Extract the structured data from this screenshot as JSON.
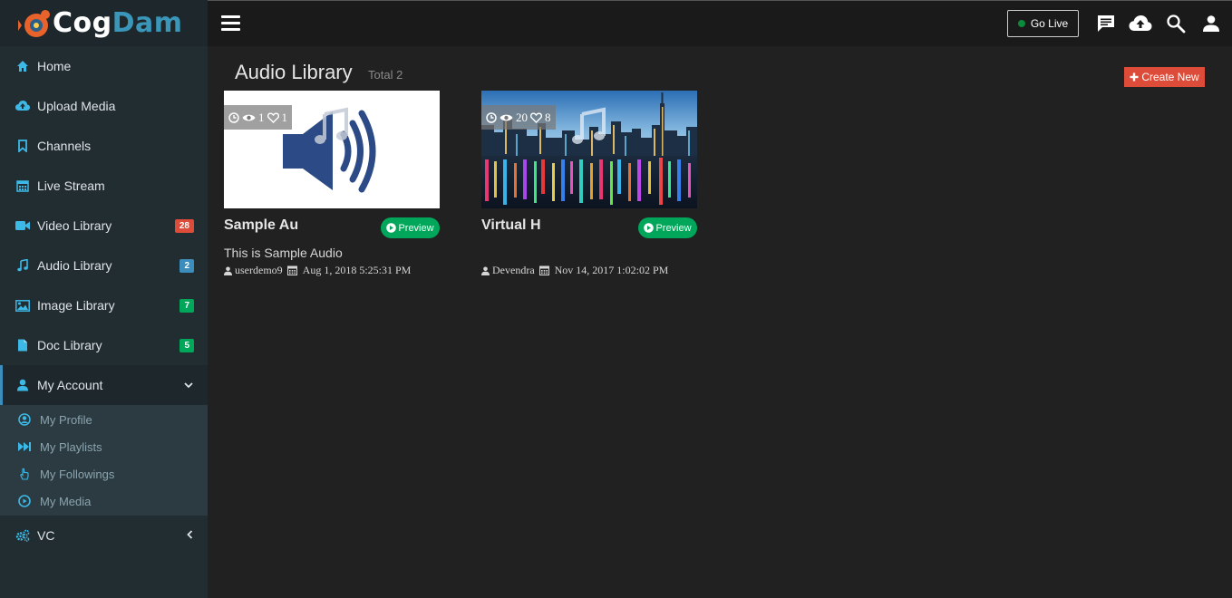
{
  "brand": {
    "logo_cog": "Cog",
    "logo_dam": "Dam"
  },
  "sidebar": {
    "items": [
      {
        "label": "Home",
        "icon": "home-icon"
      },
      {
        "label": "Upload Media",
        "icon": "cloud-upload-icon"
      },
      {
        "label": "Channels",
        "icon": "bookmark-icon"
      },
      {
        "label": "Live Stream",
        "icon": "calendar-icon"
      },
      {
        "label": "Video Library",
        "icon": "video-camera-icon",
        "badge": "28",
        "badge_color": "#dd4b39"
      },
      {
        "label": "Audio Library",
        "icon": "music-note-icon",
        "badge": "2",
        "badge_color": "#3c8dbc"
      },
      {
        "label": "Image Library",
        "icon": "image-icon",
        "badge": "7",
        "badge_color": "#00a65a"
      },
      {
        "label": "Doc Library",
        "icon": "document-icon",
        "badge": "5",
        "badge_color": "#00a65a"
      },
      {
        "label": "My Account",
        "icon": "user-icon"
      }
    ],
    "submenu": [
      {
        "label": "My Profile",
        "icon": "user-circle-icon"
      },
      {
        "label": "My Playlists",
        "icon": "fast-forward-icon"
      },
      {
        "label": "My Followings",
        "icon": "hand-pointer-icon"
      },
      {
        "label": "My Media",
        "icon": "play-circle-icon"
      }
    ],
    "vc": {
      "label": "VC",
      "icon": "cogs-icon"
    }
  },
  "header": {
    "go_live_label": "Go Live",
    "icons": [
      "chat-icon",
      "cloud-upload-icon",
      "search-icon",
      "user-icon"
    ]
  },
  "main": {
    "title": "Audio Library",
    "subtitle": "Total 2",
    "create_label": "Create New"
  },
  "cards": [
    {
      "title": "Sample Au",
      "views": "1",
      "likes": "1",
      "preview_label": "Preview",
      "description": "This is Sample Audio",
      "author": "userdemo9",
      "date": "Aug 1, 2018 5:25:31 PM"
    },
    {
      "title": "Virtual H",
      "views": "20",
      "likes": "8",
      "preview_label": "Preview",
      "description": "",
      "author": "Devendra",
      "date": "Nov 14, 2017 1:02:02 PM"
    }
  ],
  "colors": {
    "sidebar_bg": "#222d32",
    "accent_blue": "#3c8dbc",
    "red": "#dd4b39",
    "green": "#00a65a",
    "icon_blue": "#3cb9e6"
  }
}
